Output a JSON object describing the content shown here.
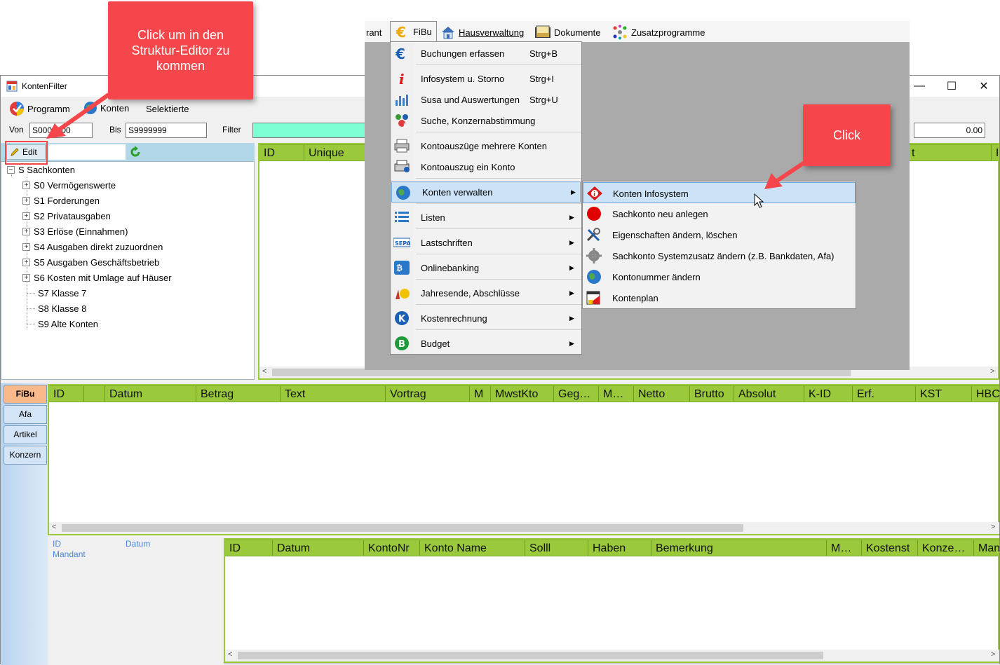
{
  "window": {
    "title": "KontenFilter",
    "controls": {
      "minimize": "—",
      "maximize": "☐",
      "close": "✕"
    }
  },
  "menubar": {
    "items": [
      {
        "label": "Programm",
        "icon": "programm-icon"
      },
      {
        "label": "Konten",
        "icon": "globe-icon"
      },
      {
        "label": "Selektierte",
        "icon": ""
      }
    ]
  },
  "filters": {
    "von_label": "Von",
    "von_value": "S0000000",
    "bis_label": "Bis",
    "bis_value": "S9999999",
    "filter_label": "Filter",
    "filter_value": "",
    "amount_value": "0.00"
  },
  "tree_panel": {
    "edit_label": "Edit",
    "root": "S Sachkonten",
    "nodes": [
      {
        "label": "S0 Vermögenswerte",
        "expandable": true
      },
      {
        "label": "S1 Forderungen",
        "expandable": true
      },
      {
        "label": "S2 Privatausgaben",
        "expandable": true
      },
      {
        "label": "S3 Erlöse (Einnahmen)",
        "expandable": true
      },
      {
        "label": "S4 Ausgaben direkt zuzuordnen",
        "expandable": true
      },
      {
        "label": "S5 Ausgaben Geschäftsbetrieb",
        "expandable": true
      },
      {
        "label": "S6 Kosten mit Umlage auf Häuser",
        "expandable": true
      },
      {
        "label": "S7 Klasse 7",
        "expandable": false
      },
      {
        "label": "S8 Klasse 8",
        "expandable": false
      },
      {
        "label": "S9 Alte Konten",
        "expandable": false
      }
    ]
  },
  "top_grid": {
    "columns": [
      "ID",
      "Unique",
      "t",
      "F"
    ]
  },
  "side_tabs": [
    "FiBu",
    "Afa",
    "Artikel",
    "Konzern"
  ],
  "mid_grid": {
    "columns": [
      "ID",
      "",
      "Datum",
      "Betrag",
      "Text",
      "Vortrag",
      "M",
      "MwstKto",
      "Geg…",
      "M…",
      "Netto",
      "Brutto",
      "Absolut",
      "K-ID",
      "Erf.",
      "KST",
      "HBC"
    ]
  },
  "detail": {
    "id_label": "ID",
    "datum_label": "Datum",
    "mandant_label": "Mandant"
  },
  "bottom_grid": {
    "columns": [
      "ID",
      "Datum",
      "KontoNr",
      "Konto Name",
      "Solll",
      "Haben",
      "Bemerkung",
      "M…",
      "Kostenst",
      "Konze…",
      "Man"
    ]
  },
  "top_menu": {
    "partial": "rant",
    "fibu": "FiBu",
    "items": [
      {
        "label": "Hausverwaltung",
        "icon": "house-icon"
      },
      {
        "label": "Dokumente",
        "icon": "documents-icon"
      },
      {
        "label": "Zusatzprogramme",
        "icon": "addons-icon"
      }
    ]
  },
  "fibu_menu": {
    "items": [
      {
        "label": "Buchungen erfassen",
        "shortcut": "Strg+B",
        "submenu": false,
        "icon": "euro-icon"
      },
      {
        "label": "Infosystem u. Storno",
        "shortcut": "Strg+I",
        "submenu": false,
        "icon": "info-icon"
      },
      {
        "label": "Susa und Auswertungen",
        "shortcut": "Strg+U",
        "submenu": false,
        "icon": "bar-chart-icon"
      },
      {
        "label": "Suche, Konzernabstimmung",
        "shortcut": "",
        "submenu": false,
        "icon": "search-group-icon"
      },
      {
        "label": "Kontoauszüge mehrere Konten",
        "shortcut": "",
        "submenu": false,
        "icon": "printer-icon"
      },
      {
        "label": "Kontoauszug ein Konto",
        "shortcut": "",
        "submenu": false,
        "icon": "printer-single-icon"
      },
      {
        "label": "Konten verwalten",
        "shortcut": "",
        "submenu": true,
        "icon": "globe-icon"
      },
      {
        "label": "Listen",
        "shortcut": "",
        "submenu": true,
        "icon": "list-icon"
      },
      {
        "label": "Lastschriften",
        "shortcut": "",
        "submenu": true,
        "icon": "sepa-icon"
      },
      {
        "label": "Onlinebanking",
        "shortcut": "",
        "submenu": true,
        "icon": "bank-icon"
      },
      {
        "label": "Jahresende, Abschlüsse",
        "shortcut": "",
        "submenu": true,
        "icon": "celebration-icon"
      },
      {
        "label": "Kostenrechnung",
        "shortcut": "",
        "submenu": true,
        "icon": "k-circle-icon"
      },
      {
        "label": "Budget",
        "shortcut": "",
        "submenu": true,
        "icon": "b-circle-icon"
      }
    ]
  },
  "konten_submenu": {
    "items": [
      {
        "label": "Konten Infosystem",
        "icon": "info-diamond-icon"
      },
      {
        "label": "Sachkonto neu anlegen",
        "icon": "red-circle-icon"
      },
      {
        "label": "Eigenschaften ändern, löschen",
        "icon": "tools-icon"
      },
      {
        "label": "Sachkonto Systemzusatz ändern (z.B. Bankdaten, Afa)",
        "icon": "gear-icon"
      },
      {
        "label": "Kontonummer ändern",
        "icon": "globe-icon"
      },
      {
        "label": "Kontenplan",
        "icon": "kontenplan-icon"
      }
    ]
  },
  "callouts": {
    "left": "Click um in den Struktur-Editor zu kommen",
    "right": "Click"
  },
  "colors": {
    "callout": "#f5474b",
    "grid_header": "#9ac93b",
    "highlight": "#cce3f7",
    "tree_header": "#b2d7e8"
  }
}
